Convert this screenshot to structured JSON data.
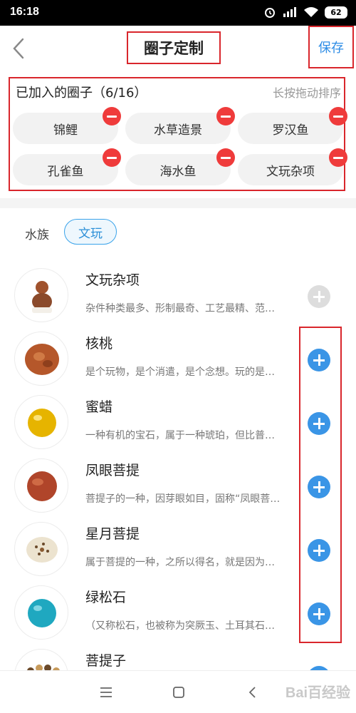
{
  "status": {
    "time": "16:18",
    "battery": "62"
  },
  "navbar": {
    "title": "圈子定制",
    "save_label": "保存"
  },
  "joined": {
    "title": "已加入的圈子（6/16）",
    "hint": "长按拖动排序",
    "chips": [
      "锦鲤",
      "水草造景",
      "罗汉鱼",
      "孔雀鱼",
      "海水鱼",
      "文玩杂项"
    ]
  },
  "tabs": [
    "水族",
    "文玩"
  ],
  "items": [
    {
      "title": "文玩杂项",
      "desc": "杂件种类最多、形制最奇、工艺最精、范…",
      "added": true
    },
    {
      "title": "核桃",
      "desc": "是个玩物，是个消遣，是个念想。玩的是…",
      "added": false
    },
    {
      "title": "蜜蜡",
      "desc": "一种有机的宝石，属于一种琥珀，但比普…",
      "added": false
    },
    {
      "title": "凤眼菩提",
      "desc": "菩提子的一种，因芽眼如目，固称“凤眼菩…",
      "added": false
    },
    {
      "title": "星月菩提",
      "desc": "属于菩提的一种，之所以得名，就是因为…",
      "added": false
    },
    {
      "title": "绿松石",
      "desc": "（又称松石，也被称为突厥玉、土耳其石…",
      "added": false
    },
    {
      "title": "菩提子",
      "desc": "",
      "added": false
    }
  ],
  "watermark": "Bai百经验"
}
